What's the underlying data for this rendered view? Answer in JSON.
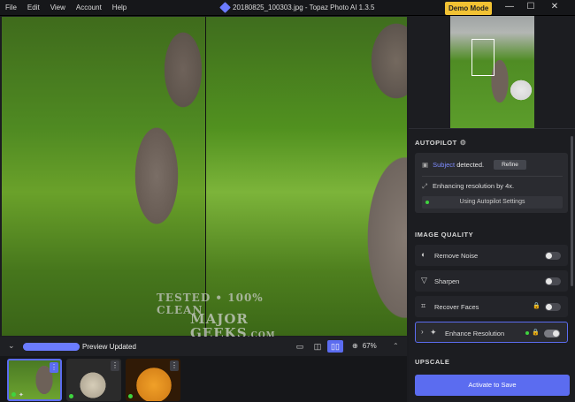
{
  "titlebar": {
    "menu": [
      "File",
      "Edit",
      "View",
      "Account",
      "Help"
    ],
    "title": "20180825_100303.jpg - Topaz Photo AI 1.3.5",
    "demo_mode": "Demo Mode",
    "controls": {
      "minimize": "—",
      "maximize": "☐",
      "close": "✕"
    }
  },
  "bottombar": {
    "preview_label": "Preview Updated",
    "progress_fraction": 1.0,
    "zoom": "67%"
  },
  "filmstrip": {
    "thumbnails": [
      {
        "name": "dog",
        "selected": true
      },
      {
        "name": "moon-eclipse",
        "selected": false
      },
      {
        "name": "orange-moon",
        "selected": false
      }
    ]
  },
  "sidebar": {
    "autopilot": {
      "heading": "AUTOPILOT",
      "subject_word": "Subject",
      "detected_text": "detected.",
      "refine_label": "Refine",
      "enhancing_text": "Enhancing resolution by 4x.",
      "using_label": "Using Autopilot Settings"
    },
    "image_quality": {
      "heading": "IMAGE QUALITY",
      "options": [
        {
          "label": "Remove Noise",
          "on": false
        },
        {
          "label": "Sharpen",
          "on": false
        },
        {
          "label": "Recover Faces",
          "on": false
        },
        {
          "label": "Enhance Resolution",
          "on": true
        }
      ]
    },
    "upscale_heading": "UPSCALE",
    "activate_label": "Activate to Save"
  },
  "watermark": {
    "line1": "TESTED • 100% CLEAN",
    "line2": "MAJOR",
    "line3": "GEEKS",
    "tail": ".COM",
    "stars": "★★★★★★★"
  },
  "colors": {
    "accent": "#5b6cf0",
    "demo": "#f2c233",
    "ok": "#3fd43f"
  }
}
